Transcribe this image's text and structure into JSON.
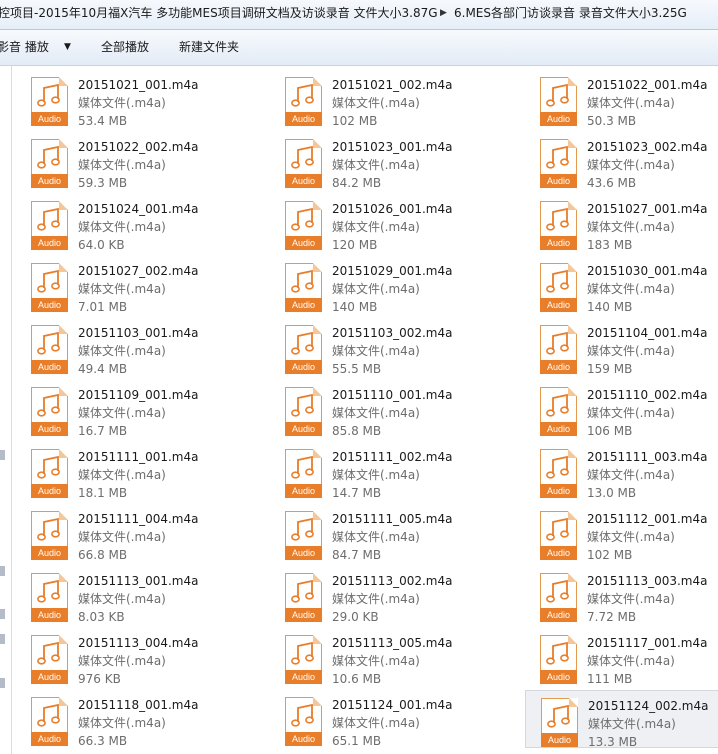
{
  "address": {
    "segment1": "控项目-2015年10月福X汽车 多功能MES项目调研文档及访谈录音 文件大小3.87G",
    "separator": "▶",
    "segment2": "6.MES各部门访谈录音 录音文件大小3.25G"
  },
  "toolbar": {
    "play_label": "影音 播放",
    "play_arrow": "▼",
    "play_all_label": "全部播放",
    "new_folder_label": "新建文件夹"
  },
  "icon_label": "Audio",
  "accent_color": "#e87e2a",
  "files": [
    {
      "name": "20151021_001.m4a",
      "type": "媒体文件(.m4a)",
      "size": "53.4 MB"
    },
    {
      "name": "20151021_002.m4a",
      "type": "媒体文件(.m4a)",
      "size": "102 MB"
    },
    {
      "name": "20151022_001.m4a",
      "type": "媒体文件(.m4a)",
      "size": "50.3 MB"
    },
    {
      "name": "20151022_002.m4a",
      "type": "媒体文件(.m4a)",
      "size": "59.3 MB"
    },
    {
      "name": "20151023_001.m4a",
      "type": "媒体文件(.m4a)",
      "size": "84.2 MB"
    },
    {
      "name": "20151023_002.m4a",
      "type": "媒体文件(.m4a)",
      "size": "43.6 MB"
    },
    {
      "name": "20151024_001.m4a",
      "type": "媒体文件(.m4a)",
      "size": "64.0 KB"
    },
    {
      "name": "20151026_001.m4a",
      "type": "媒体文件(.m4a)",
      "size": "120 MB"
    },
    {
      "name": "20151027_001.m4a",
      "type": "媒体文件(.m4a)",
      "size": "183 MB"
    },
    {
      "name": "20151027_002.m4a",
      "type": "媒体文件(.m4a)",
      "size": "7.01 MB"
    },
    {
      "name": "20151029_001.m4a",
      "type": "媒体文件(.m4a)",
      "size": "140 MB"
    },
    {
      "name": "20151030_001.m4a",
      "type": "媒体文件(.m4a)",
      "size": "140 MB"
    },
    {
      "name": "20151103_001.m4a",
      "type": "媒体文件(.m4a)",
      "size": "49.4 MB"
    },
    {
      "name": "20151103_002.m4a",
      "type": "媒体文件(.m4a)",
      "size": "55.5 MB"
    },
    {
      "name": "20151104_001.m4a",
      "type": "媒体文件(.m4a)",
      "size": "159 MB"
    },
    {
      "name": "20151109_001.m4a",
      "type": "媒体文件(.m4a)",
      "size": "16.7 MB"
    },
    {
      "name": "20151110_001.m4a",
      "type": "媒体文件(.m4a)",
      "size": "85.8 MB"
    },
    {
      "name": "20151110_002.m4a",
      "type": "媒体文件(.m4a)",
      "size": "106 MB"
    },
    {
      "name": "20151111_001.m4a",
      "type": "媒体文件(.m4a)",
      "size": "18.1 MB"
    },
    {
      "name": "20151111_002.m4a",
      "type": "媒体文件(.m4a)",
      "size": "14.7 MB"
    },
    {
      "name": "20151111_003.m4a",
      "type": "媒体文件(.m4a)",
      "size": "13.0 MB"
    },
    {
      "name": "20151111_004.m4a",
      "type": "媒体文件(.m4a)",
      "size": "66.8 MB"
    },
    {
      "name": "20151111_005.m4a",
      "type": "媒体文件(.m4a)",
      "size": "84.7 MB"
    },
    {
      "name": "20151112_001.m4a",
      "type": "媒体文件(.m4a)",
      "size": "102 MB"
    },
    {
      "name": "20151113_001.m4a",
      "type": "媒体文件(.m4a)",
      "size": "8.03 KB"
    },
    {
      "name": "20151113_002.m4a",
      "type": "媒体文件(.m4a)",
      "size": "29.0 KB"
    },
    {
      "name": "20151113_003.m4a",
      "type": "媒体文件(.m4a)",
      "size": "7.72 MB"
    },
    {
      "name": "20151113_004.m4a",
      "type": "媒体文件(.m4a)",
      "size": "976 KB"
    },
    {
      "name": "20151113_005.m4a",
      "type": "媒体文件(.m4a)",
      "size": "10.6 MB"
    },
    {
      "name": "20151117_001.m4a",
      "type": "媒体文件(.m4a)",
      "size": "111 MB"
    },
    {
      "name": "20151118_001.m4a",
      "type": "媒体文件(.m4a)",
      "size": "66.3 MB"
    },
    {
      "name": "20151124_001.m4a",
      "type": "媒体文件(.m4a)",
      "size": "65.1 MB"
    },
    {
      "name": "20151124_002.m4a",
      "type": "媒体文件(.m4a)",
      "size": "13.3 MB",
      "selected": true
    }
  ]
}
